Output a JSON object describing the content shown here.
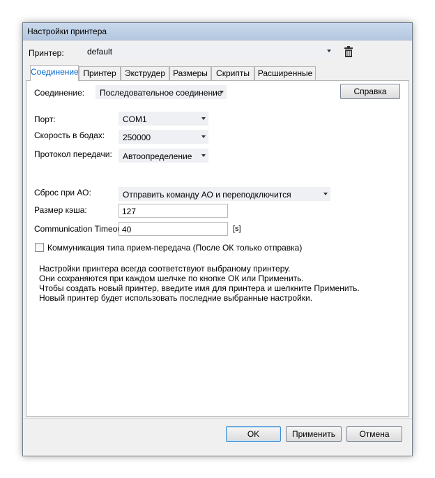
{
  "window": {
    "title": "Настройки принтера"
  },
  "printer": {
    "label": "Принтер:",
    "value": "default"
  },
  "tabs": [
    {
      "label": "Соединение",
      "active": true
    },
    {
      "label": "Принтер"
    },
    {
      "label": "Экструдер"
    },
    {
      "label": "Размеры"
    },
    {
      "label": "Скрипты"
    },
    {
      "label": "Расширенные"
    }
  ],
  "connection": {
    "label": "Соединение:",
    "value": "Последовательное соединение",
    "help_button": "Справка"
  },
  "port": {
    "label": "Порт:",
    "value": "COM1"
  },
  "baud": {
    "label": "Скорость в бодах:",
    "value": "250000"
  },
  "protocol": {
    "label": "Протокол передачи:",
    "value": "Автоопределение"
  },
  "reset": {
    "label": "Сброс при АО:",
    "value": "Отправить команду АО и переподключится"
  },
  "cache": {
    "label": "Размер кэша:",
    "value": "127"
  },
  "timeout": {
    "label": "Communication Timeout:",
    "value": "40",
    "unit": "[s]"
  },
  "pingpong": {
    "label": "Коммуникация типа прием-передача (После ОК только отправка)",
    "checked": false
  },
  "note": [
    "Настройки принтера всегда соответствуют выбраному принтеру.",
    "Они сохраняются при каждом шелчке по кнопке ОК или Применить.",
    "Чтобы создать новый принтер, введите имя для принтера и шелкните Применить.",
    "Новый принтер будет использовать последние выбранные настройки."
  ],
  "buttons": {
    "ok": "OK",
    "apply": "Применить",
    "cancel": "Отмена"
  }
}
